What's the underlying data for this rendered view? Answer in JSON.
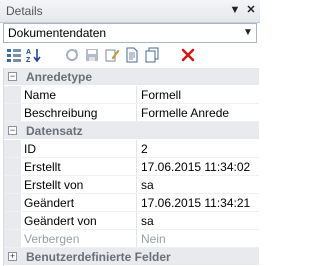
{
  "panel": {
    "title": "Details"
  },
  "dropdown": {
    "value": "Dokumentendaten"
  },
  "toolbar": {
    "icons": [
      "sort-categorized-icon",
      "sort-alphabetical-icon",
      "refresh-icon",
      "save-icon",
      "edit-icon",
      "new-document-icon",
      "copy-icon",
      "delete-icon"
    ]
  },
  "categories": [
    {
      "label": "Anredetype",
      "expanded": true,
      "rows": [
        {
          "name": "Name",
          "value": "Formell"
        },
        {
          "name": "Beschreibung",
          "value": "Formelle Anrede"
        }
      ]
    },
    {
      "label": "Datensatz",
      "expanded": true,
      "rows": [
        {
          "name": "ID",
          "value": "2"
        },
        {
          "name": "Erstellt",
          "value": "17.06.2015 11:34:02"
        },
        {
          "name": "Erstellt von",
          "value": "sa"
        },
        {
          "name": "Geändert",
          "value": "17.06.2015 11:34:21"
        },
        {
          "name": "Geändert von",
          "value": "sa"
        },
        {
          "name": "Verbergen",
          "value": "Nein",
          "disabled": true
        }
      ]
    },
    {
      "label": "Benutzerdefinierte Felder",
      "expanded": false,
      "rows": []
    }
  ],
  "colors": {
    "accent": "#3a6ea5",
    "delete": "#d01818"
  }
}
